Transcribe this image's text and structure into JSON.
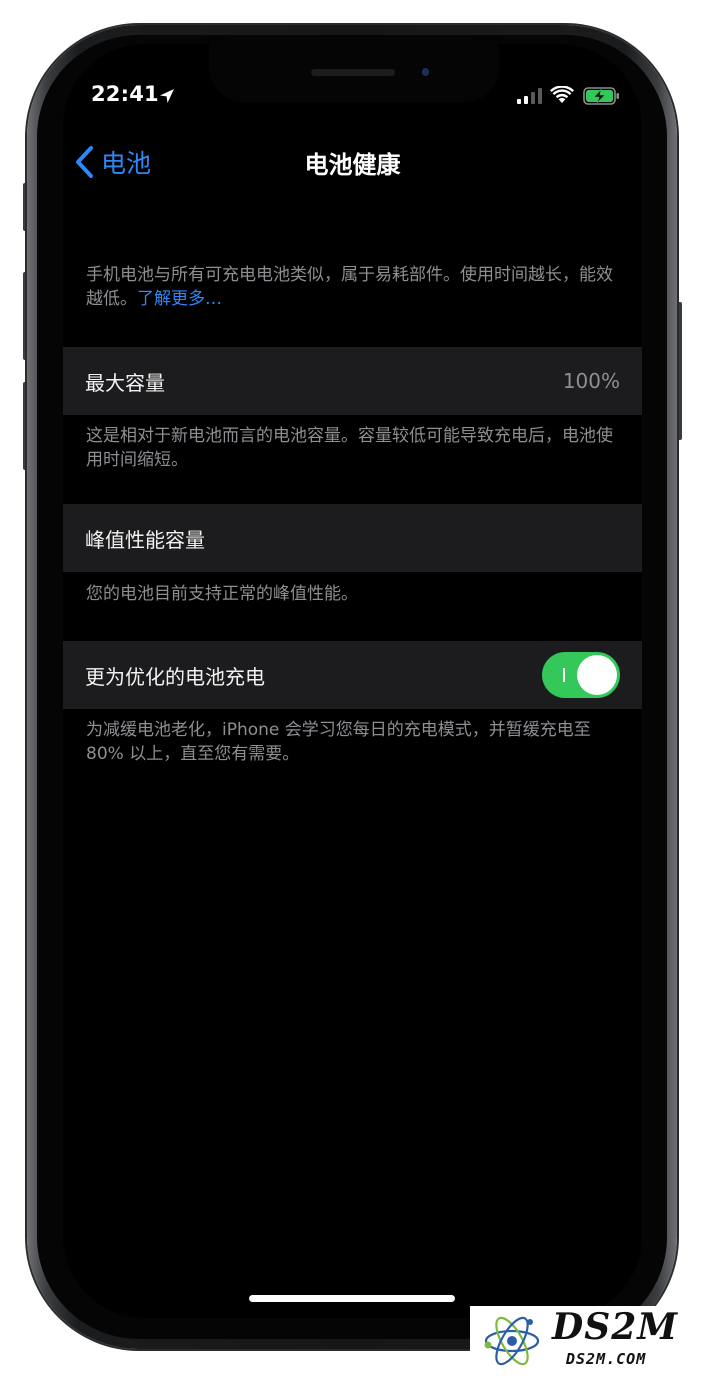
{
  "status_bar": {
    "time": "22:41",
    "location_icon": "location-arrow-icon",
    "signal_icon": "cellular-signal-icon",
    "wifi_icon": "wifi-icon",
    "battery_icon": "battery-charging-icon"
  },
  "nav": {
    "back_label": "电池",
    "title": "电池健康"
  },
  "intro": {
    "text": "手机电池与所有可充电电池类似，属于易耗部件。使用时间越长，能效越低。",
    "link": "了解更多…"
  },
  "max_capacity": {
    "label": "最大容量",
    "value": "100%",
    "footnote": "这是相对于新电池而言的电池容量。容量较低可能导致充电后，电池使用时间缩短。"
  },
  "peak_performance": {
    "label": "峰值性能容量",
    "footnote": "您的电池目前支持正常的峰值性能。"
  },
  "optimized_charging": {
    "label": "更为优化的电池充电",
    "enabled": true,
    "footnote": "为减缓电池老化，iPhone 会学习您每日的充电模式，并暂缓充电至 80% 以上，直至您有需要。"
  },
  "colors": {
    "accent_blue": "#2f86f6",
    "toggle_green": "#34c759",
    "row_bg": "#1c1c1e",
    "footnote_gray": "#8e8e93"
  },
  "watermark": {
    "title": "DS2M",
    "subtitle": "DS2M.COM"
  }
}
